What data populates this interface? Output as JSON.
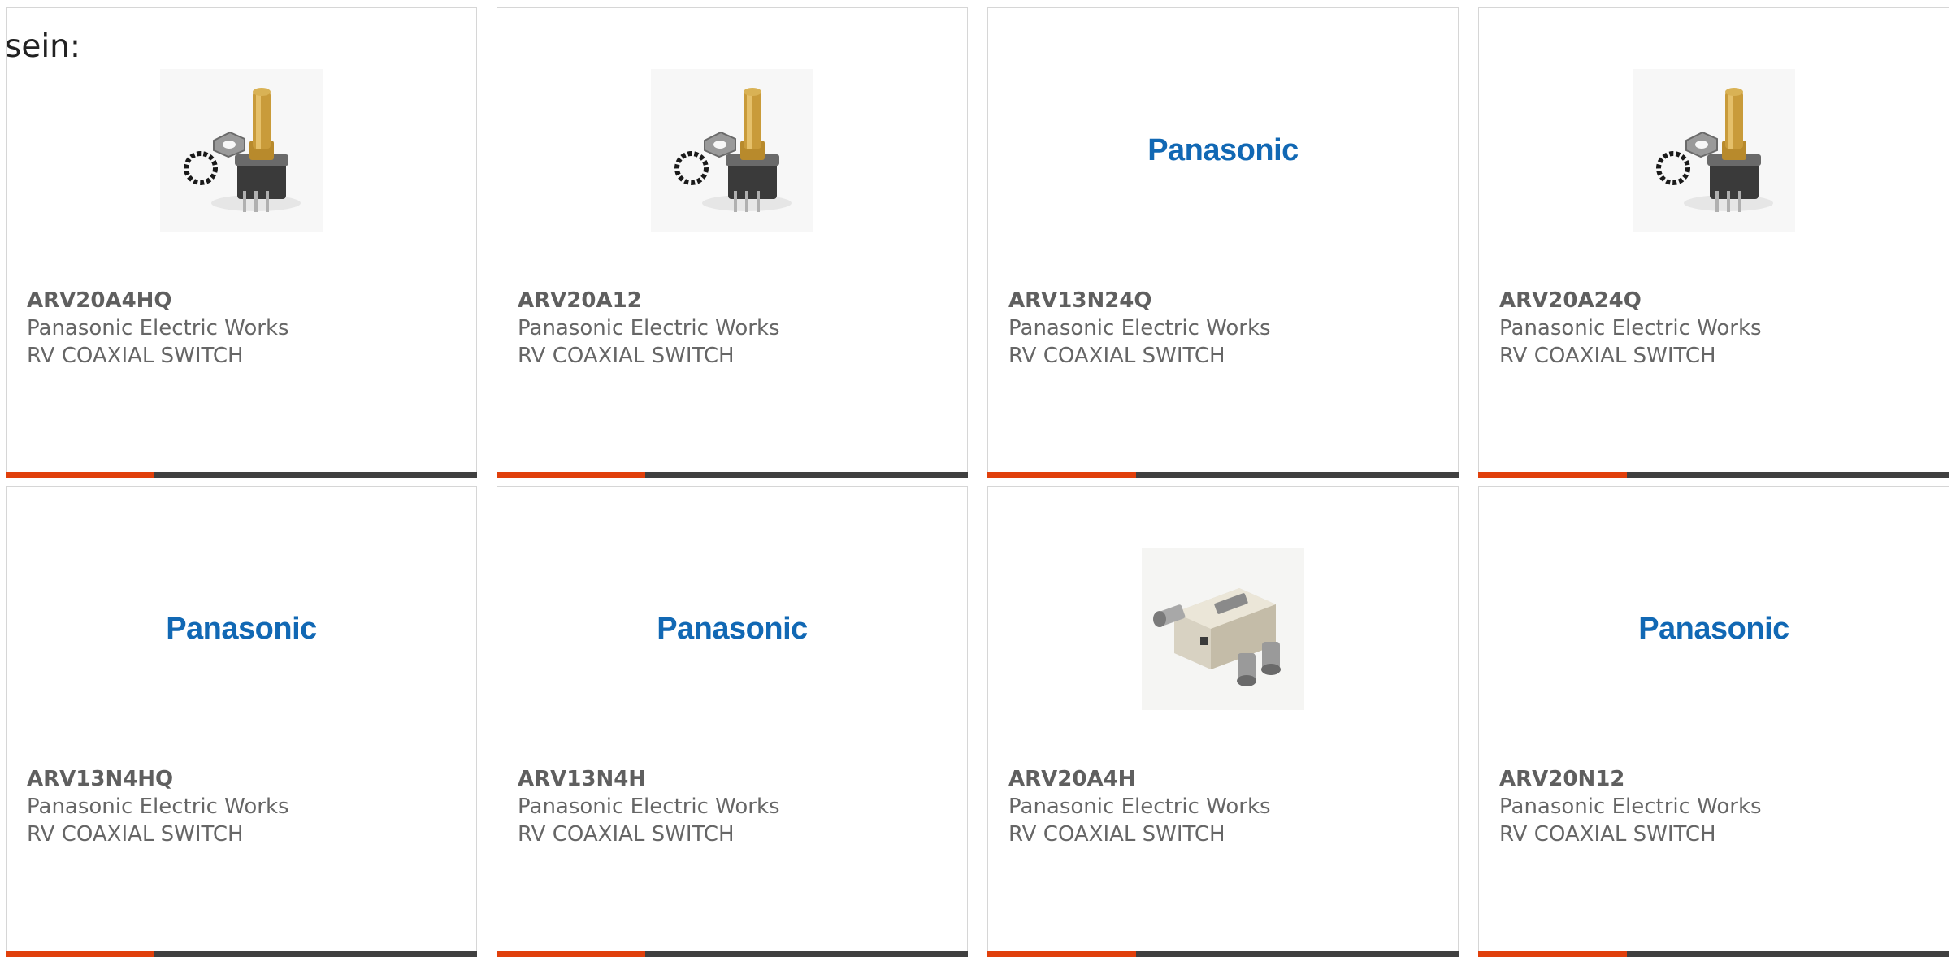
{
  "lead_text": "sein:",
  "colors": {
    "accent": "#e0400c",
    "bar": "#404040",
    "panasonic_blue": "#1168b4"
  },
  "products": [
    {
      "part_number": "ARV20A4HQ",
      "manufacturer": "Panasonic Electric Works",
      "description": "RV COAXIAL SWITCH",
      "image": "rotary-potentiometer-photo"
    },
    {
      "part_number": "ARV20A12",
      "manufacturer": "Panasonic Electric Works",
      "description": "RV COAXIAL SWITCH",
      "image": "rotary-potentiometer-photo"
    },
    {
      "part_number": "ARV13N24Q",
      "manufacturer": "Panasonic Electric Works",
      "description": "RV COAXIAL SWITCH",
      "image": "panasonic-logo",
      "logo_text": "Panasonic"
    },
    {
      "part_number": "ARV20A24Q",
      "manufacturer": "Panasonic Electric Works",
      "description": "RV COAXIAL SWITCH",
      "image": "rotary-potentiometer-photo"
    },
    {
      "part_number": "ARV13N4HQ",
      "manufacturer": "Panasonic Electric Works",
      "description": "RV COAXIAL SWITCH",
      "image": "panasonic-logo",
      "logo_text": "Panasonic"
    },
    {
      "part_number": "ARV13N4H",
      "manufacturer": "Panasonic Electric Works",
      "description": "RV COAXIAL SWITCH",
      "image": "panasonic-logo",
      "logo_text": "Panasonic"
    },
    {
      "part_number": "ARV20A4H",
      "manufacturer": "Panasonic Electric Works",
      "description": "RV COAXIAL SWITCH",
      "image": "coaxial-switch-photo"
    },
    {
      "part_number": "ARV20N12",
      "manufacturer": "Panasonic Electric Works",
      "description": "RV COAXIAL SWITCH",
      "image": "panasonic-logo",
      "logo_text": "Panasonic"
    }
  ]
}
